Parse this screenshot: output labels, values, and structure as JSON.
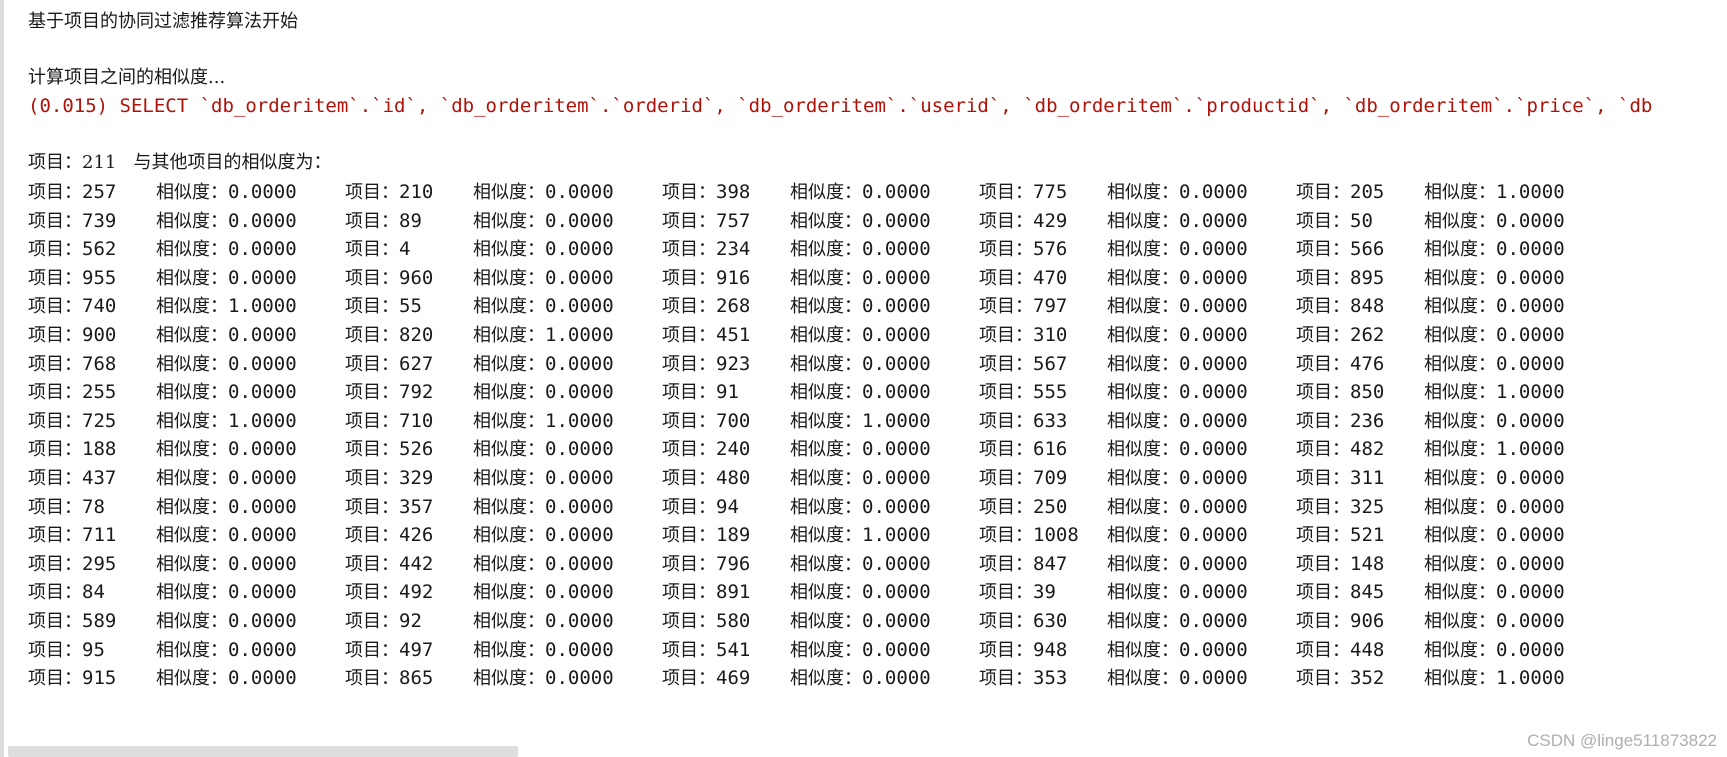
{
  "header_line": "基于项目的协同过滤推荐算法开始",
  "computing_line": "计算项目之间的相似度...",
  "sql_line": "(0.015) SELECT `db_orderitem`.`id`, `db_orderitem`.`orderid`, `db_orderitem`.`userid`, `db_orderitem`.`productid`, `db_orderitem`.`price`, `db",
  "item_header": "项目：211   与其他项目的相似度为：",
  "item_prefix": "项目：",
  "sim_prefix": "相似度：",
  "rows": [
    [
      [
        "257",
        "0.0000"
      ],
      [
        "210",
        "0.0000"
      ],
      [
        "398",
        "0.0000"
      ],
      [
        "775",
        "0.0000"
      ],
      [
        "205",
        "1.0000"
      ]
    ],
    [
      [
        "739",
        "0.0000"
      ],
      [
        "89",
        "0.0000"
      ],
      [
        "757",
        "0.0000"
      ],
      [
        "429",
        "0.0000"
      ],
      [
        "50",
        "0.0000"
      ]
    ],
    [
      [
        "562",
        "0.0000"
      ],
      [
        "4",
        "0.0000"
      ],
      [
        "234",
        "0.0000"
      ],
      [
        "576",
        "0.0000"
      ],
      [
        "566",
        "0.0000"
      ]
    ],
    [
      [
        "955",
        "0.0000"
      ],
      [
        "960",
        "0.0000"
      ],
      [
        "916",
        "0.0000"
      ],
      [
        "470",
        "0.0000"
      ],
      [
        "895",
        "0.0000"
      ]
    ],
    [
      [
        "740",
        "1.0000"
      ],
      [
        "55",
        "0.0000"
      ],
      [
        "268",
        "0.0000"
      ],
      [
        "797",
        "0.0000"
      ],
      [
        "848",
        "0.0000"
      ]
    ],
    [
      [
        "900",
        "0.0000"
      ],
      [
        "820",
        "1.0000"
      ],
      [
        "451",
        "0.0000"
      ],
      [
        "310",
        "0.0000"
      ],
      [
        "262",
        "0.0000"
      ]
    ],
    [
      [
        "768",
        "0.0000"
      ],
      [
        "627",
        "0.0000"
      ],
      [
        "923",
        "0.0000"
      ],
      [
        "567",
        "0.0000"
      ],
      [
        "476",
        "0.0000"
      ]
    ],
    [
      [
        "255",
        "0.0000"
      ],
      [
        "792",
        "0.0000"
      ],
      [
        "91",
        "0.0000"
      ],
      [
        "555",
        "0.0000"
      ],
      [
        "850",
        "1.0000"
      ]
    ],
    [
      [
        "725",
        "1.0000"
      ],
      [
        "710",
        "1.0000"
      ],
      [
        "700",
        "1.0000"
      ],
      [
        "633",
        "0.0000"
      ],
      [
        "236",
        "0.0000"
      ]
    ],
    [
      [
        "188",
        "0.0000"
      ],
      [
        "526",
        "0.0000"
      ],
      [
        "240",
        "0.0000"
      ],
      [
        "616",
        "0.0000"
      ],
      [
        "482",
        "1.0000"
      ]
    ],
    [
      [
        "437",
        "0.0000"
      ],
      [
        "329",
        "0.0000"
      ],
      [
        "480",
        "0.0000"
      ],
      [
        "709",
        "0.0000"
      ],
      [
        "311",
        "0.0000"
      ]
    ],
    [
      [
        "78",
        "0.0000"
      ],
      [
        "357",
        "0.0000"
      ],
      [
        "94",
        "0.0000"
      ],
      [
        "250",
        "0.0000"
      ],
      [
        "325",
        "0.0000"
      ]
    ],
    [
      [
        "711",
        "0.0000"
      ],
      [
        "426",
        "0.0000"
      ],
      [
        "189",
        "1.0000"
      ],
      [
        "1008",
        "0.0000"
      ],
      [
        "521",
        "0.0000"
      ]
    ],
    [
      [
        "295",
        "0.0000"
      ],
      [
        "442",
        "0.0000"
      ],
      [
        "796",
        "0.0000"
      ],
      [
        "847",
        "0.0000"
      ],
      [
        "148",
        "0.0000"
      ]
    ],
    [
      [
        "84",
        "0.0000"
      ],
      [
        "492",
        "0.0000"
      ],
      [
        "891",
        "0.0000"
      ],
      [
        "39",
        "0.0000"
      ],
      [
        "845",
        "0.0000"
      ]
    ],
    [
      [
        "589",
        "0.0000"
      ],
      [
        "92",
        "0.0000"
      ],
      [
        "580",
        "0.0000"
      ],
      [
        "630",
        "0.0000"
      ],
      [
        "906",
        "0.0000"
      ]
    ],
    [
      [
        "95",
        "0.0000"
      ],
      [
        "497",
        "0.0000"
      ],
      [
        "541",
        "0.0000"
      ],
      [
        "948",
        "0.0000"
      ],
      [
        "448",
        "0.0000"
      ]
    ],
    [
      [
        "915",
        "0.0000"
      ],
      [
        "865",
        "0.0000"
      ],
      [
        "469",
        "0.0000"
      ],
      [
        "353",
        "0.0000"
      ],
      [
        "352",
        "1.0000"
      ]
    ]
  ],
  "watermark": "CSDN @linge511873822"
}
